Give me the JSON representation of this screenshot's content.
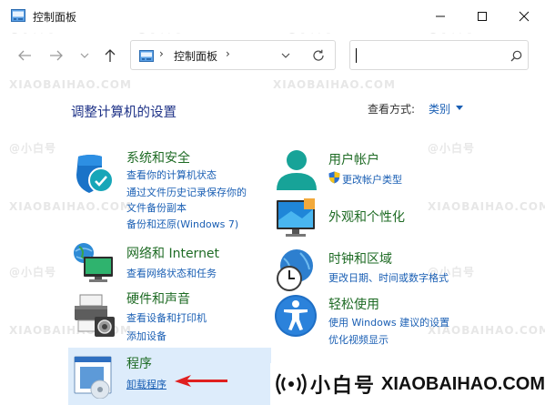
{
  "window": {
    "title": "控制面板"
  },
  "address": {
    "path": "控制面板",
    "sep": "›"
  },
  "search": {
    "placeholder": ""
  },
  "header": {
    "title": "调整计算机的设置",
    "view_by_label": "查看方式:",
    "view_by_value": "类别"
  },
  "categories": {
    "system": {
      "title": "系统和安全",
      "links": [
        "查看你的计算机状态",
        "通过文件历史记录保存你的",
        "文件备份副本",
        "备份和还原(Windows 7)"
      ]
    },
    "network": {
      "title": "网络和 Internet",
      "links": [
        "查看网络状态和任务"
      ]
    },
    "hardware": {
      "title": "硬件和声音",
      "links": [
        "查看设备和打印机",
        "添加设备"
      ]
    },
    "programs": {
      "title": "程序",
      "links": [
        "卸载程序"
      ]
    },
    "users": {
      "title": "用户帐户",
      "links": [
        "更改帐户类型"
      ]
    },
    "appearance": {
      "title": "外观和个性化",
      "links": []
    },
    "clock": {
      "title": "时钟和区域",
      "links": [
        "更改日期、时间或数字格式"
      ]
    },
    "ease": {
      "title": "轻松使用",
      "links": [
        "使用 Windows 建议的设置",
        "优化视频显示"
      ]
    }
  },
  "watermark": {
    "cn": "@小白号",
    "en": "XIAOBAIHAO.COM",
    "brand_cn": "小白号",
    "brand_en": "XIAOBAIHAO.COM"
  },
  "colors": {
    "category_title": "#1e6b24",
    "link": "#1a5fb4",
    "heading": "#1e3287",
    "highlight": "#ddecfb"
  }
}
